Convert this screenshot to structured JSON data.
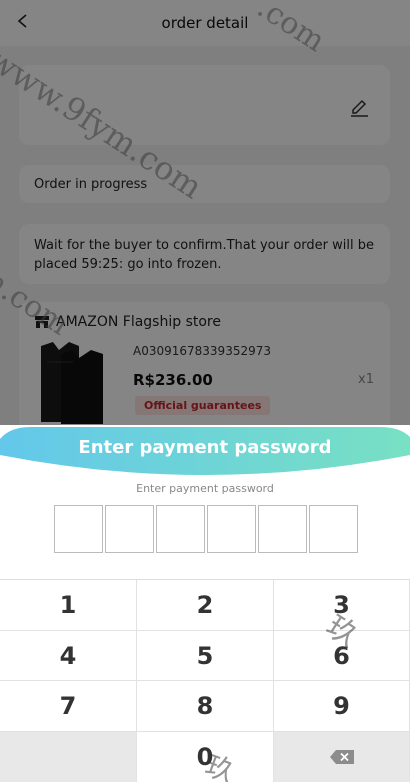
{
  "header": {
    "title": "order detail"
  },
  "status": {
    "text": "Order in progress"
  },
  "notice": {
    "text": "Wait for the buyer to confirm.That your order will be placed 59:25: go into frozen."
  },
  "product": {
    "store_name": "AMAZON Flagship store",
    "sku": "A03091678339352973",
    "price": "R$236.00",
    "quantity": "x1",
    "badge": "Official guarantees"
  },
  "payment": {
    "title": "Enter payment password",
    "subtitle": "Enter payment password",
    "pin_boxes": [
      "",
      "",
      "",
      "",
      "",
      ""
    ],
    "keys": [
      "1",
      "2",
      "3",
      "4",
      "5",
      "6",
      "7",
      "8",
      "9",
      "",
      "0",
      ""
    ]
  },
  "watermarks": [
    "www.9fym.com",
    ".com",
    "m.com",
    "玖",
    "玖"
  ],
  "colors": {
    "banner_gradient_start": "#63c8ea",
    "banner_gradient_end": "#78e0c3",
    "badge_text": "#c5252d",
    "badge_bg": "#fde5e3"
  },
  "icons": [
    "back-icon",
    "edit-icon",
    "store-icon",
    "delete-icon"
  ]
}
